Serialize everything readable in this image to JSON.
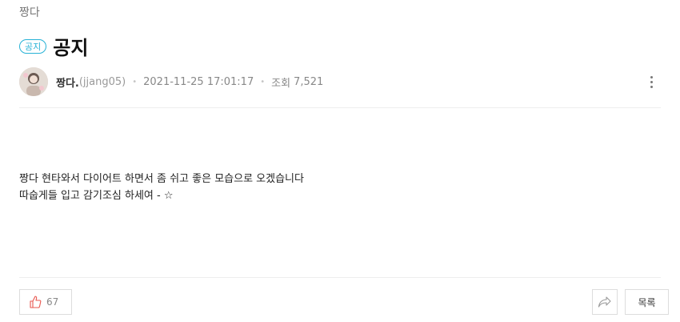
{
  "board": {
    "name": "짱다"
  },
  "post": {
    "badge": "공지",
    "title": "공지",
    "author_nick": "짱다.",
    "author_id": "(jjang05)",
    "date": "2021-11-25 17:01:17",
    "views_label": "조회",
    "views": "7,521",
    "body_lines": [
      "짱다 현타와서 다이어트 하면서 좀 쉬고 좋은 모습으로 오겠습니다",
      "따숩게들 입고 감기조심 하세여 - ☆"
    ]
  },
  "footer": {
    "like_count": "67",
    "list_label": "목록"
  },
  "icons": {
    "like": "thumbs-up-icon",
    "share": "share-icon",
    "more": "more-vertical-icon"
  },
  "colors": {
    "accent": "#27b2d6",
    "like": "#e8574f"
  }
}
